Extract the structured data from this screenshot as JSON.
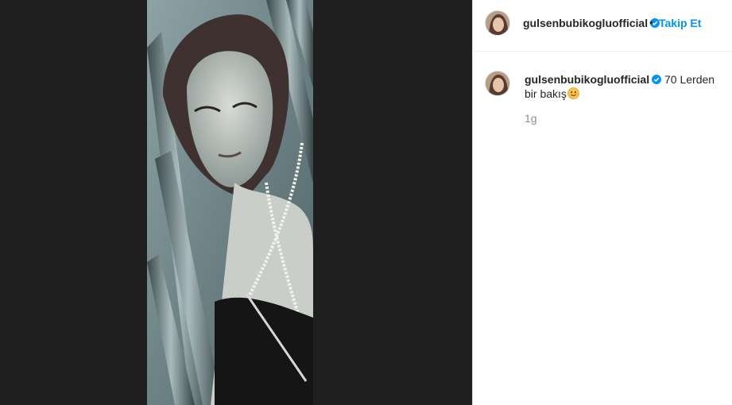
{
  "post": {
    "username": "gulsenbubikogluofficial",
    "follow_label": "Takip Et",
    "separator": "•",
    "caption": "70 Lerden bir bakış",
    "time_ago": "1g"
  },
  "icons": {
    "verified": "verified-badge-icon",
    "emoji": "smiling-face-emoji"
  },
  "colors": {
    "accent": "#0095f6",
    "text": "#262626",
    "muted": "#8e8e8e",
    "media_background": "#1f1f1f"
  }
}
